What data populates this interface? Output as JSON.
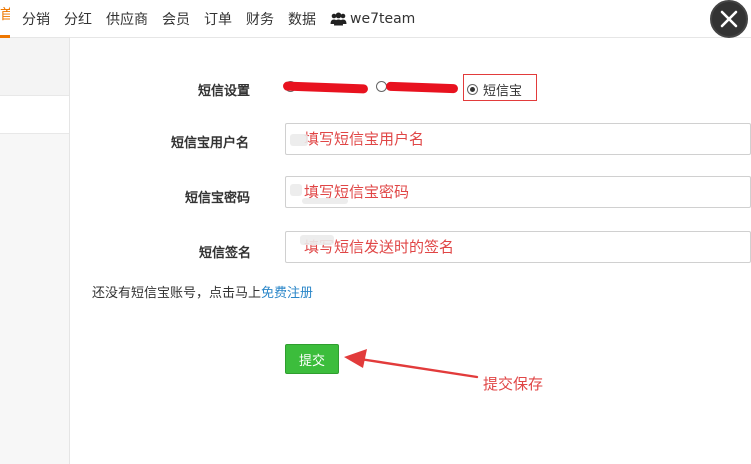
{
  "topnav": {
    "active_partial": "首页",
    "items": [
      "分销",
      "分红",
      "供应商",
      "会员",
      "订单",
      "财务",
      "数据"
    ],
    "team_label": "we7team"
  },
  "form": {
    "sms_setting_label": "短信设置",
    "sms_options": [
      {
        "label": "短信宝",
        "selected": true
      }
    ],
    "username_label": "短信宝用户名",
    "username_annotation": "填写短信宝用户名",
    "password_label": "短信宝密码",
    "password_annotation": "填写短信宝密码",
    "signature_label": "短信签名",
    "signature_annotation": "填写短信发送时的签名",
    "register_prefix": "还没有短信宝账号，点击马上",
    "register_link": "免费注册",
    "submit_label": "提交"
  },
  "annotation": {
    "text": "提交保存",
    "color": "#e04646"
  },
  "colors": {
    "accent": "#ee7700",
    "submit": "#3cbd3c",
    "link": "#2a86c8",
    "annotation_red": "#e23b3b"
  }
}
